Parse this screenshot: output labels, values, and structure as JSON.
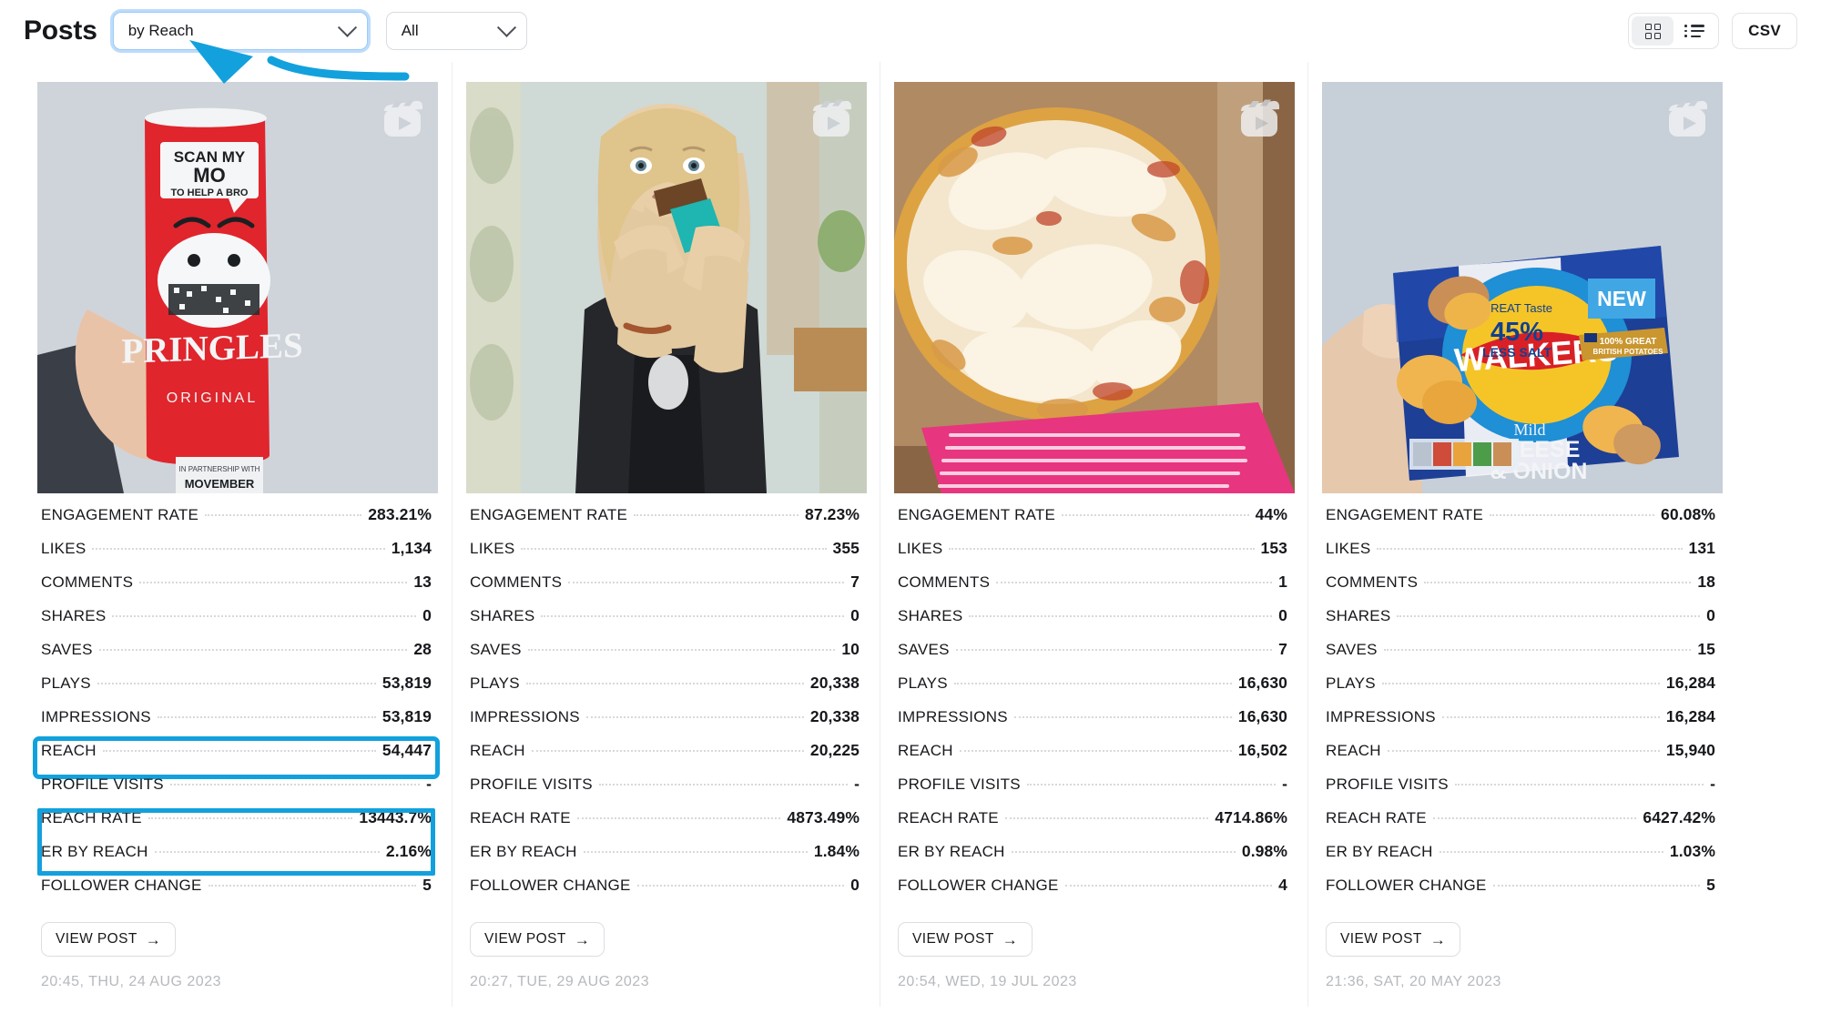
{
  "header": {
    "title": "Posts",
    "sort_select": {
      "value": "by Reach",
      "icon": "chevron-down-icon"
    },
    "filter_select": {
      "value": "All",
      "icon": "chevron-down-icon"
    },
    "grid_view_icon": "grid-view-icon",
    "list_view_icon": "list-view-icon",
    "csv_label": "CSV",
    "active_view": "grid"
  },
  "annotation": {
    "arrow_color": "#12a1dd",
    "points_at": "by Reach"
  },
  "highlight": {
    "color": "#12a1dd",
    "rows": [
      "REACH",
      "REACH RATE",
      "ER BY REACH"
    ],
    "card_index": 0
  },
  "metric_labels": [
    "ENGAGEMENT RATE",
    "LIKES",
    "COMMENTS",
    "SHARES",
    "SAVES",
    "PLAYS",
    "IMPRESSIONS",
    "REACH",
    "PROFILE VISITS",
    "REACH RATE",
    "ER BY REACH",
    "FOLLOWER CHANGE"
  ],
  "view_post_label": "VIEW POST",
  "view_post_arrow": "→",
  "cards": [
    {
      "media_icon": "reels-icon",
      "thumbnail_subject": "pringles-can",
      "values": {
        "ENGAGEMENT RATE": "283.21%",
        "LIKES": "1,134",
        "COMMENTS": "13",
        "SHARES": "0",
        "SAVES": "28",
        "PLAYS": "53,819",
        "IMPRESSIONS": "53,819",
        "REACH": "54,447",
        "PROFILE VISITS": "-",
        "REACH RATE": "13443.7%",
        "ER BY REACH": "2.16%",
        "FOLLOWER CHANGE": "5"
      },
      "timestamp": "20:45, THU, 24 AUG 2023"
    },
    {
      "media_icon": "reels-icon",
      "thumbnail_subject": "woman-eating-snack",
      "values": {
        "ENGAGEMENT RATE": "87.23%",
        "LIKES": "355",
        "COMMENTS": "7",
        "SHARES": "0",
        "SAVES": "10",
        "PLAYS": "20,338",
        "IMPRESSIONS": "20,338",
        "REACH": "20,225",
        "PROFILE VISITS": "-",
        "REACH RATE": "4873.49%",
        "ER BY REACH": "1.84%",
        "FOLLOWER CHANGE": "0"
      },
      "timestamp": "20:27, TUE, 29 AUG 2023"
    },
    {
      "media_icon": "reels-icon",
      "thumbnail_subject": "pizza-in-box",
      "values": {
        "ENGAGEMENT RATE": "44%",
        "LIKES": "153",
        "COMMENTS": "1",
        "SHARES": "0",
        "SAVES": "7",
        "PLAYS": "16,630",
        "IMPRESSIONS": "16,630",
        "REACH": "16,502",
        "PROFILE VISITS": "-",
        "REACH RATE": "4714.86%",
        "ER BY REACH": "0.98%",
        "FOLLOWER CHANGE": "4"
      },
      "timestamp": "20:54, WED, 19 JUL 2023"
    },
    {
      "media_icon": "reels-icon",
      "thumbnail_subject": "walkers-crisps-bag",
      "values": {
        "ENGAGEMENT RATE": "60.08%",
        "LIKES": "131",
        "COMMENTS": "18",
        "SHARES": "0",
        "SAVES": "15",
        "PLAYS": "16,284",
        "IMPRESSIONS": "16,284",
        "REACH": "15,940",
        "PROFILE VISITS": "-",
        "REACH RATE": "6427.42%",
        "ER BY REACH": "1.03%",
        "FOLLOWER CHANGE": "5"
      },
      "timestamp": "21:36, SAT, 20 MAY 2023"
    }
  ]
}
